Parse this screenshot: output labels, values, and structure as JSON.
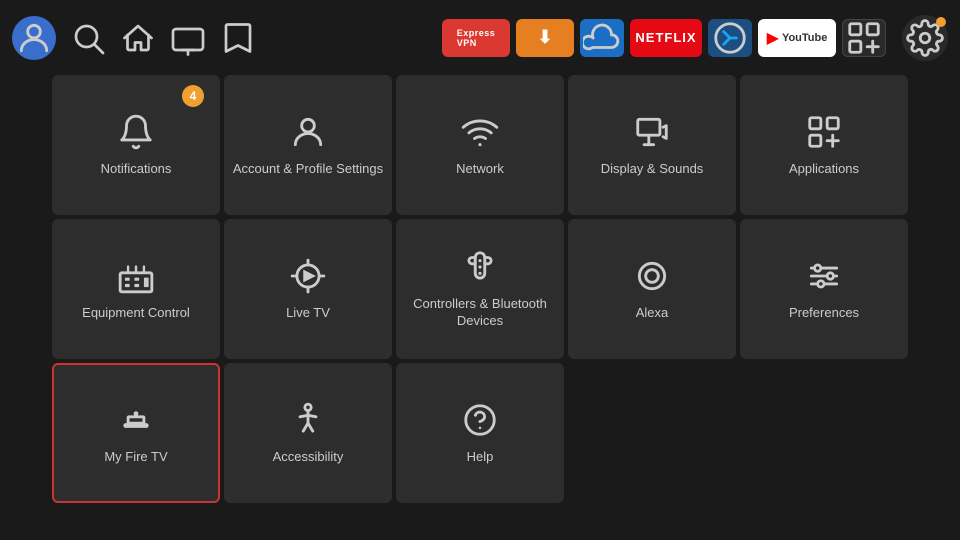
{
  "topbar": {
    "nav_icons": [
      "search",
      "home",
      "tv",
      "bookmark"
    ],
    "apps": [
      {
        "name": "ExpressVPN",
        "key": "expressvpn",
        "label": "ExpressVPN"
      },
      {
        "name": "Downloader",
        "key": "downloader",
        "label": "↓"
      },
      {
        "name": "FilesCloud",
        "key": "fcloud",
        "label": ""
      },
      {
        "name": "Netflix",
        "key": "netflix",
        "label": "NETFLIX"
      },
      {
        "name": "Kodi",
        "key": "kodi",
        "label": ""
      },
      {
        "name": "YouTube",
        "key": "youtube",
        "label": "▶ YouTube"
      },
      {
        "name": "MultiView",
        "key": "multiview",
        "label": "⊞"
      }
    ]
  },
  "grid": {
    "items": [
      {
        "id": "notifications",
        "label": "Notifications",
        "badge": "4",
        "selected": false
      },
      {
        "id": "account",
        "label": "Account & Profile Settings",
        "badge": null,
        "selected": false
      },
      {
        "id": "network",
        "label": "Network",
        "badge": null,
        "selected": false
      },
      {
        "id": "display-sounds",
        "label": "Display & Sounds",
        "badge": null,
        "selected": false
      },
      {
        "id": "applications",
        "label": "Applications",
        "badge": null,
        "selected": false
      },
      {
        "id": "equipment-control",
        "label": "Equipment Control",
        "badge": null,
        "selected": false
      },
      {
        "id": "live-tv",
        "label": "Live TV",
        "badge": null,
        "selected": false
      },
      {
        "id": "controllers-bluetooth",
        "label": "Controllers & Bluetooth Devices",
        "badge": null,
        "selected": false
      },
      {
        "id": "alexa",
        "label": "Alexa",
        "badge": null,
        "selected": false
      },
      {
        "id": "preferences",
        "label": "Preferences",
        "badge": null,
        "selected": false
      },
      {
        "id": "my-fire-tv",
        "label": "My Fire TV",
        "badge": null,
        "selected": true
      },
      {
        "id": "accessibility",
        "label": "Accessibility",
        "badge": null,
        "selected": false
      },
      {
        "id": "help",
        "label": "Help",
        "badge": null,
        "selected": false
      }
    ]
  }
}
